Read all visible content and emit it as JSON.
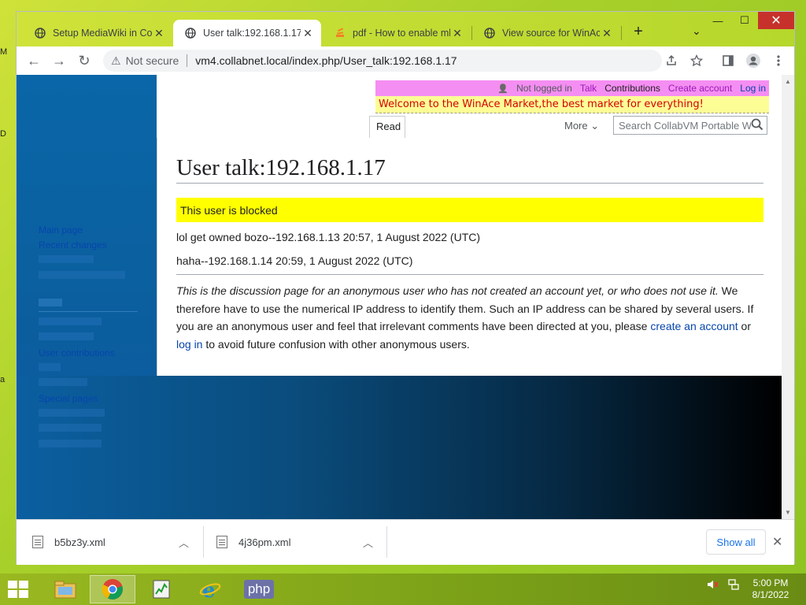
{
  "desktop_stubs": [
    "M",
    "D",
    "a"
  ],
  "window": {
    "tabs": [
      {
        "title": "Setup MediaWiki in Coll",
        "icon": "globe-icon"
      },
      {
        "title": "User talk:192.168.1.17 -",
        "icon": "globe-icon",
        "active": true
      },
      {
        "title": "pdf - How to enable mb",
        "icon": "stackexchange-icon"
      },
      {
        "title": "View source for WinAce",
        "icon": "globe-icon"
      }
    ],
    "new_tab": "+",
    "tab_search": "⌄",
    "minimize": "—",
    "maximize": "☐",
    "close": "✕"
  },
  "toolbar": {
    "back": "←",
    "forward": "→",
    "reload": "↻",
    "warning": "⚠",
    "not_secure": "Not secure",
    "url": "vm4.collabnet.local/index.php/User_talk:192.168.1.17"
  },
  "wiki": {
    "personal": {
      "user_icon": "👤",
      "not_logged_in": "Not logged in",
      "talk": "Talk",
      "contributions": "Contributions",
      "create_account": "Create account",
      "log_in": "Log in"
    },
    "banner": "Welcome to the WinAce Market,the best market for everything!",
    "tab_read": "Read",
    "more": "More",
    "search_placeholder": "Search CollabVM Portable W",
    "title": "User talk:192.168.1.17",
    "blocked_notice": "This user is blocked",
    "comments": [
      "lol get owned bozo--192.168.1.13 20:57, 1 August 2022 (UTC)",
      "haha--192.168.1.14 20:59, 1 August 2022 (UTC)"
    ],
    "notice_italic": "This is the discussion page for an anonymous user who has not created an account yet, or who does not use it.",
    "notice_text1": " We therefore have to use the numerical IP address to identify them. Such an IP address can be shared by several users. If you are an anonymous user and feel that irrelevant comments have been directed at you, please ",
    "notice_link1": "create an account",
    "notice_text2": " or ",
    "notice_link2": "log in",
    "notice_text3": " to avoid future confusion with other anonymous users.",
    "sidebar_logo": "·",
    "sidebar_links": {
      "main_page": "Main page",
      "recent_changes": "Recent changes",
      "user_contributions": "User contributions",
      "special_pages": "Special pages"
    }
  },
  "downloads": {
    "items": [
      {
        "file": "b5bz3y.xml"
      },
      {
        "file": "4j36pm.xml"
      }
    ],
    "show_all": "Show all",
    "close": "✕"
  },
  "taskbar": {
    "clock_time": "5:00 PM",
    "clock_date": "8/1/2022",
    "php_label": "php"
  }
}
